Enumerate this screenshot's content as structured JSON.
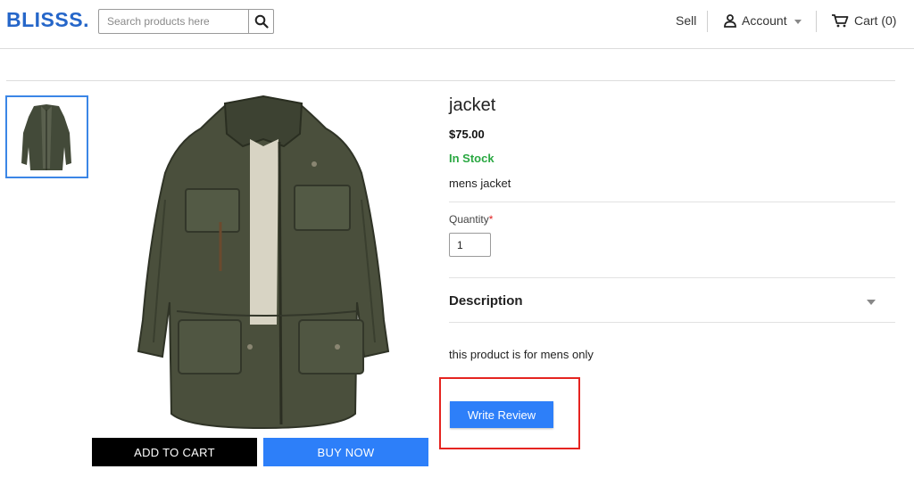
{
  "header": {
    "logo": "BLISSS",
    "logo_dot": ".",
    "search_placeholder": "Search products here",
    "nav": {
      "sell": "Sell",
      "account": "Account",
      "cart": "Cart (0)"
    }
  },
  "product": {
    "title": "jacket",
    "price": "$75.00",
    "stock": "In Stock",
    "short_description": "mens jacket",
    "quantity_label": "Quantity",
    "quantity_required_mark": "*",
    "quantity_value": "1",
    "description_heading": "Description",
    "description_text": "this product is for mens only"
  },
  "actions": {
    "add_to_cart": "ADD TO CART",
    "buy_now": "BUY NOW",
    "write_review": "Write Review"
  },
  "colors": {
    "brand": "#2566c9",
    "primary_button": "#2d7ff9",
    "in_stock": "#2aa842",
    "highlight": "#e52420"
  }
}
